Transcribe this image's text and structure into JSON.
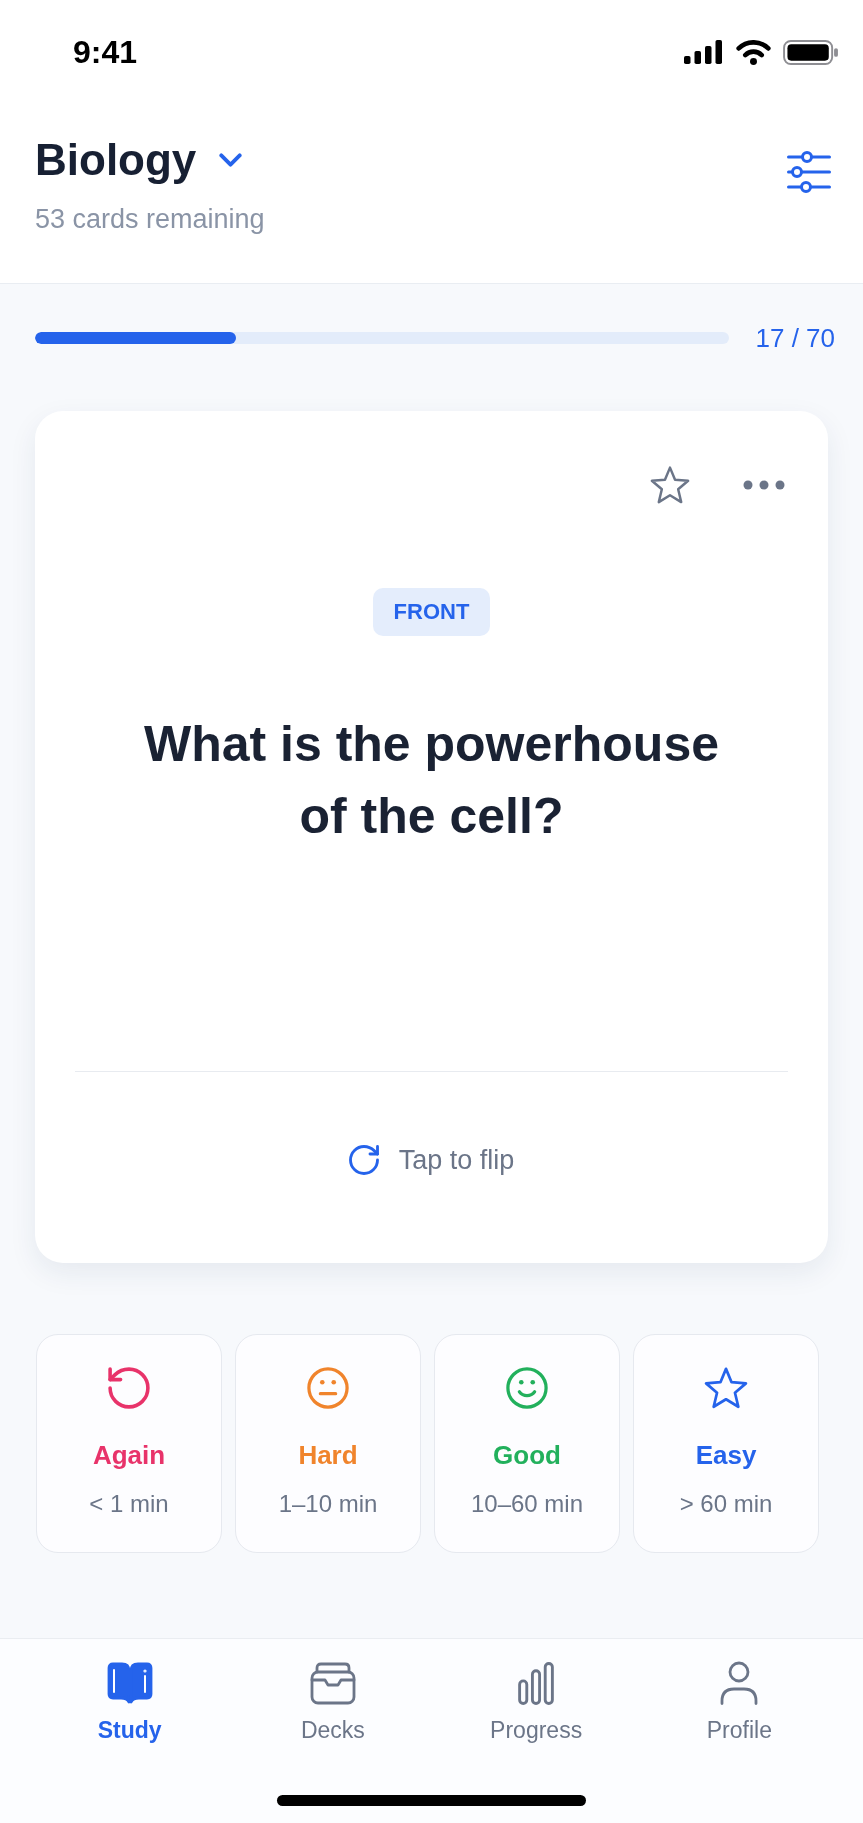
{
  "status_bar": {
    "time": "9:41"
  },
  "header": {
    "title": "Biology",
    "subtitle": "53 cards remaining"
  },
  "progress": {
    "level": 0.29,
    "reading": "17 / 70"
  },
  "card": {
    "starred": false,
    "side": "FRONT",
    "question": "What is the powerhouse of the cell?",
    "hint": "Tap to flip"
  },
  "ratings": [
    {
      "kind": "again",
      "label": "Again",
      "interval": "< 1 min",
      "color": "#e8336a"
    },
    {
      "kind": "hard",
      "label": "Hard",
      "interval": "1–10 min",
      "color": "#f0842c"
    },
    {
      "kind": "good",
      "label": "Good",
      "interval": "10–60 min",
      "color": "#22b05c"
    },
    {
      "kind": "easy",
      "label": "Easy",
      "interval": "> 60 min",
      "color": "#2563eb"
    }
  ],
  "tab_bar": {
    "items": [
      {
        "kind": "study",
        "label": "Study",
        "selected": true
      },
      {
        "kind": "decks",
        "label": "Decks",
        "selected": false
      },
      {
        "kind": "progress",
        "label": "Progress",
        "selected": false
      },
      {
        "kind": "profile",
        "label": "Profile",
        "selected": false
      }
    ]
  }
}
